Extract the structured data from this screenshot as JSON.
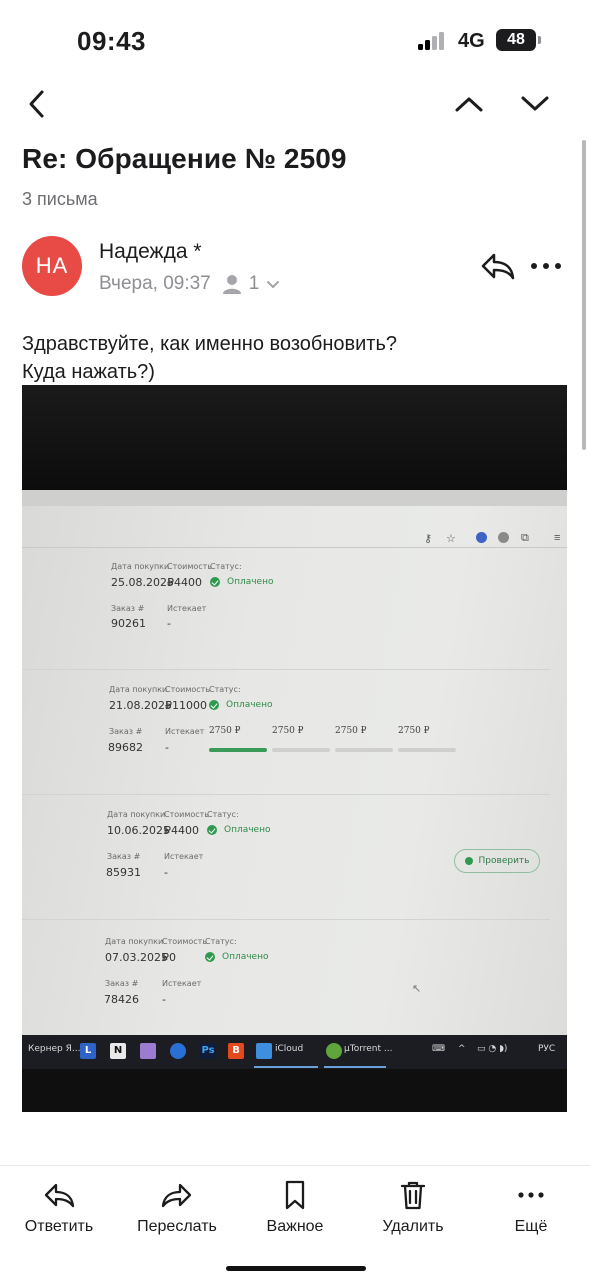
{
  "status_bar": {
    "time": "09:43",
    "network": "4G",
    "battery": "48"
  },
  "nav": {
    "back_icon": "chevron-left-icon",
    "prev_icon": "chevron-up-icon",
    "next_icon": "chevron-down-icon"
  },
  "email": {
    "subject": "Re: Обращение № 2509",
    "thread_count": "3 письма",
    "avatar_initials": "НА",
    "avatar_color": "#e84b45",
    "sender": "Надежда *",
    "date": "Вчера, 09:37",
    "recipients_count": "1",
    "body_line1": "Здравствуйте, как именно возобновить?",
    "body_line2": "Куда нажать?)"
  },
  "photo": {
    "labels": {
      "purchase_date": "Дата покупки",
      "cost": "Стоимость",
      "status": "Статус:",
      "order": "Заказ #",
      "expires": "Истекает"
    },
    "orders": [
      {
        "date": "25.08.2025",
        "cost": "₽4400",
        "status": "Оплачено",
        "order": "90261",
        "expires": "-"
      },
      {
        "date": "21.08.2025",
        "cost": "₽11000",
        "status": "Оплачено",
        "order": "89682",
        "expires": "-",
        "installments": [
          "2750 ₽",
          "2750 ₽",
          "2750 ₽",
          "2750 ₽"
        ],
        "paid_installments": 1,
        "button": "Проверить"
      },
      {
        "date": "10.06.2025",
        "cost": "₽4400",
        "status": "Оплачено",
        "order": "85931",
        "expires": "-"
      },
      {
        "date": "07.03.2025",
        "cost": "₽0",
        "status": "Оплачено",
        "order": "78426",
        "expires": "-"
      }
    ],
    "taskbar": {
      "item1": "Кернер Я...",
      "icloud": "iCloud",
      "utorrent": "µTorrent ...",
      "lang": "РУС"
    },
    "accent_green": "#2f9a4f"
  },
  "toolbar": {
    "reply": "Ответить",
    "forward": "Переслать",
    "important": "Важное",
    "delete": "Удалить",
    "more": "Ещё"
  }
}
